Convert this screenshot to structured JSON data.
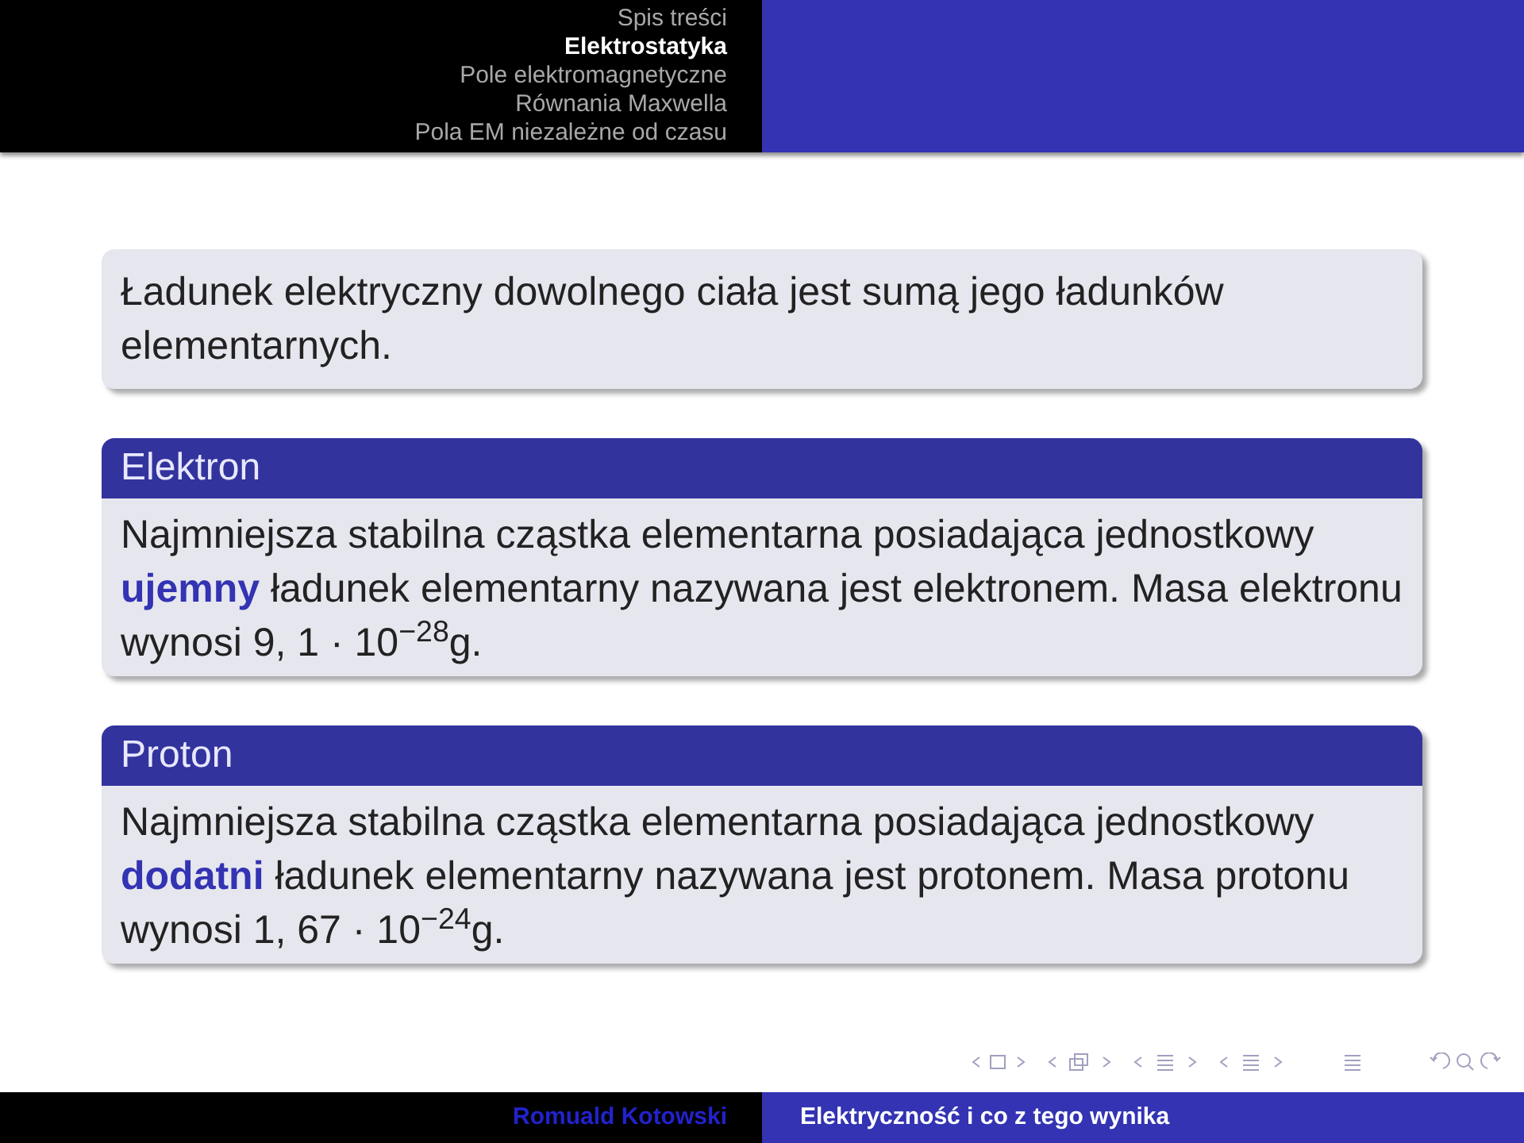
{
  "header": {
    "sections": [
      {
        "label": "Spis treści",
        "selected": false
      },
      {
        "label": "Elektrostatyka",
        "selected": true
      },
      {
        "label": "Pole elektromagnetyczne",
        "selected": false
      },
      {
        "label": "Równania Maxwella",
        "selected": false
      },
      {
        "label": "Pola EM niezależne od czasu",
        "selected": false
      }
    ]
  },
  "blocks": [
    {
      "kind": "plain",
      "text": "Ładunek elektryczny dowolnego ciała jest sumą jego ładunków elementarnych."
    },
    {
      "kind": "titled",
      "title": "Elektron",
      "text": "Najmniejsza stabilna cząstka elementarna posiadająca jednostkowy **ujemny** ładunek elementarny nazywana jest elektronem. Masa elektronu wynosi 9, 1 · 10$^{−28}$g."
    },
    {
      "kind": "titled",
      "title": "Proton",
      "text": "Najmniejsza stabilna cząstka elementarna posiadająca jednostkowy **dodatni** ładunek elementarny nazywana jest protonem. Masa protonu wynosi 1, 67 · 10$^{−24}$g."
    }
  ],
  "footer": {
    "author": "Romuald Kotowski",
    "title": "Elektryczność i co z tego wynika"
  }
}
